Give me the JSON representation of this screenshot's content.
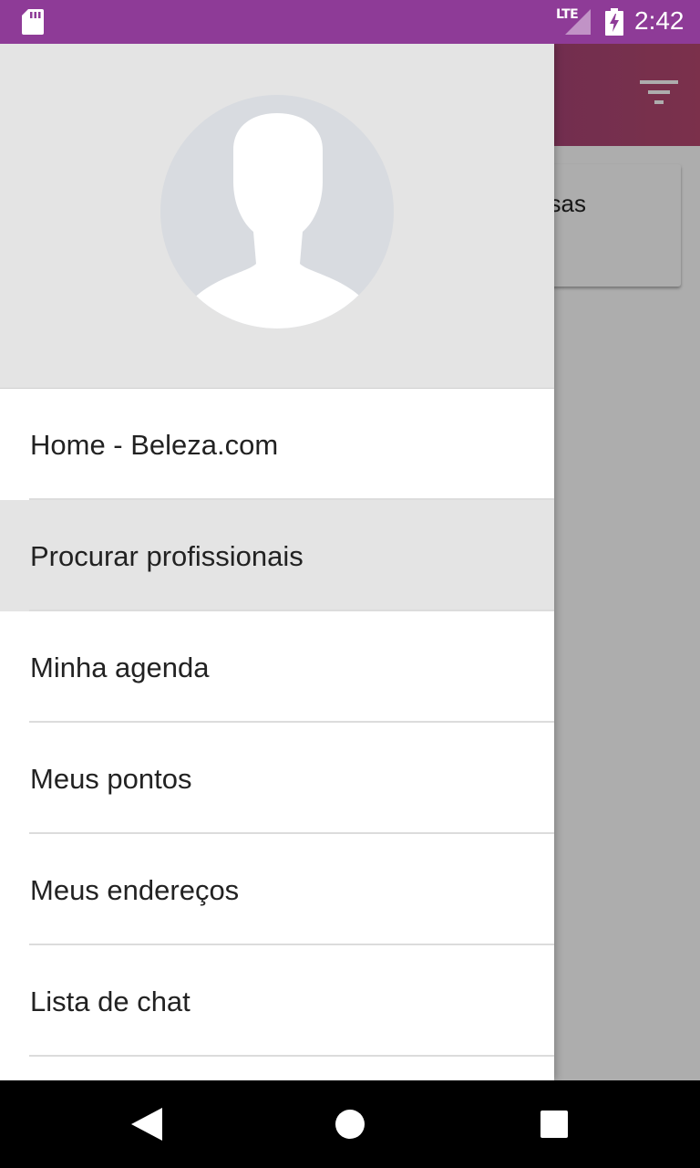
{
  "status_bar": {
    "network": "LTE",
    "time": "2:42",
    "icons": [
      "sd-card-icon",
      "lte-signal-icon",
      "battery-charging-icon"
    ],
    "color": "#8e3b97"
  },
  "background_app": {
    "toolbar_icon": "filter-icon",
    "card_text_visible": "sas"
  },
  "drawer": {
    "avatar_icon": "user-avatar-placeholder-icon",
    "menu": [
      {
        "label": "Home - Beleza.com",
        "selected": false
      },
      {
        "label": "Procurar profissionais",
        "selected": true
      },
      {
        "label": "Minha agenda",
        "selected": false
      },
      {
        "label": "Meus pontos",
        "selected": false
      },
      {
        "label": "Meus endereços",
        "selected": false
      },
      {
        "label": "Lista de chat",
        "selected": false
      }
    ]
  },
  "nav_bar": {
    "buttons": [
      "back-icon",
      "home-icon",
      "recent-apps-icon"
    ]
  }
}
